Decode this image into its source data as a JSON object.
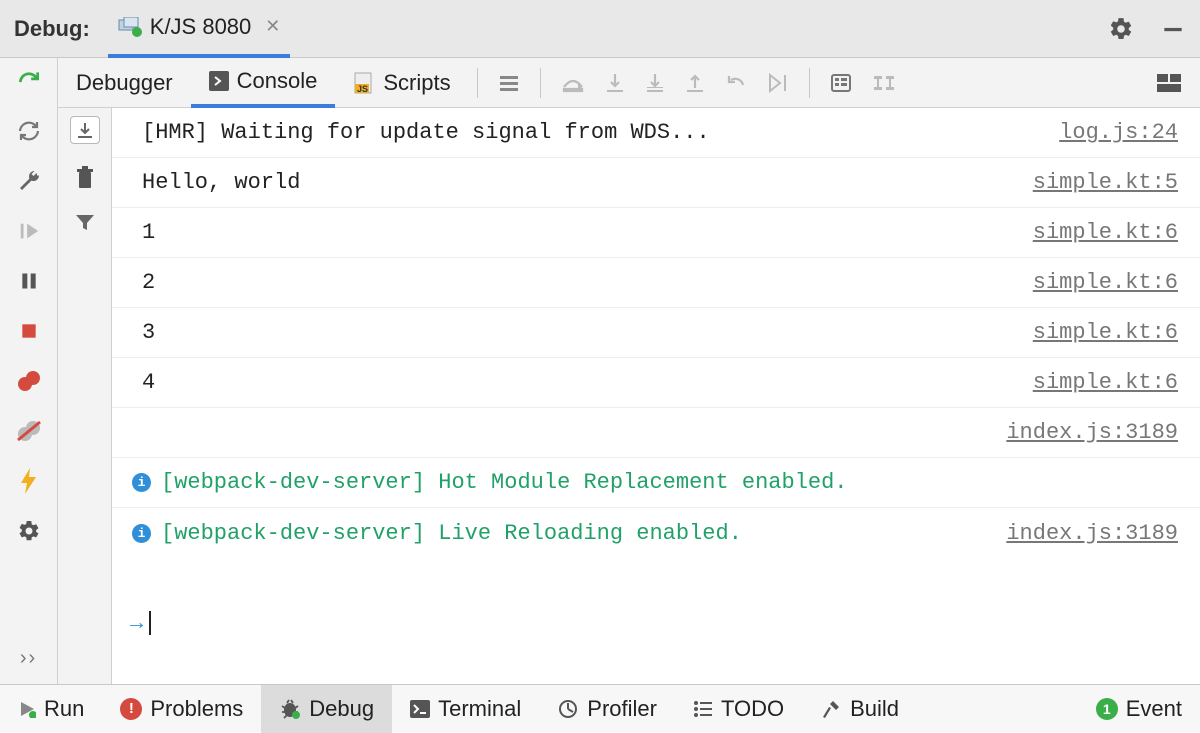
{
  "header": {
    "label": "Debug:",
    "tab": "K/JS 8080"
  },
  "tabs": {
    "debugger": "Debugger",
    "console": "Console",
    "scripts": "Scripts"
  },
  "console": {
    "rows": [
      {
        "msg": "[HMR] Waiting for update signal from WDS...",
        "src": "log.js:24",
        "type": "plain"
      },
      {
        "msg": "Hello, world",
        "src": "simple.kt:5",
        "type": "plain"
      },
      {
        "msg": "1",
        "src": "simple.kt:6",
        "type": "plain"
      },
      {
        "msg": "2",
        "src": "simple.kt:6",
        "type": "plain"
      },
      {
        "msg": "3",
        "src": "simple.kt:6",
        "type": "plain"
      },
      {
        "msg": "4",
        "src": "simple.kt:6",
        "type": "plain"
      },
      {
        "msg": "",
        "src": "index.js:3189",
        "type": "plain"
      },
      {
        "msg": "[webpack-dev-server] Hot Module Replacement enabled.",
        "src": "",
        "type": "info"
      },
      {
        "msg": "[webpack-dev-server] Live Reloading enabled.",
        "src": "index.js:3189",
        "type": "info"
      }
    ]
  },
  "bottom": {
    "run": "Run",
    "problems": "Problems",
    "debug": "Debug",
    "terminal": "Terminal",
    "profiler": "Profiler",
    "todo": "TODO",
    "build": "Build",
    "event": "Event",
    "event_count": "1"
  }
}
